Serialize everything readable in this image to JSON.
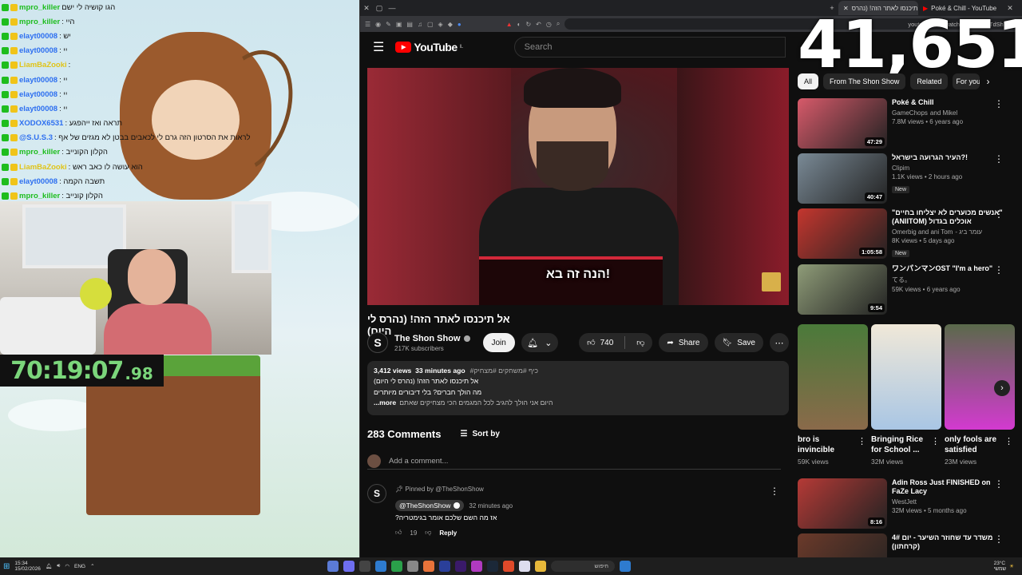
{
  "stream": {
    "chat": [
      {
        "name": "mpro_killer",
        "msg": "הגו קושיה לי ישם",
        "color": "green"
      },
      {
        "name": "mpro_killer",
        "msg": ": היי",
        "color": "green"
      },
      {
        "name": "elayt00008",
        "msg": ": יש",
        "color": "blue"
      },
      {
        "name": "elayt00008",
        "msg": ": יי",
        "color": "blue"
      },
      {
        "name": "LiamBaZooki",
        "msg": ":",
        "color": "yellow"
      },
      {
        "name": "elayt00008",
        "msg": ": יי",
        "color": "blue"
      },
      {
        "name": "elayt00008",
        "msg": ": יי",
        "color": "blue"
      },
      {
        "name": "elayt00008",
        "msg": ": יי",
        "color": "blue"
      },
      {
        "name": "XODOX6531",
        "msg": ": תראה ואז ייהפגע",
        "color": "blue"
      },
      {
        "name": "@S.U.S.3",
        "msg": ": לראות את הסרטון הזה גרם לי לכאבים בבטן לא מגזים של אף",
        "color": "blue"
      },
      {
        "name": "mpro_killer",
        "msg": ": הקלון הקונייב",
        "color": "green"
      },
      {
        "name": "LiamBaZooki",
        "msg": ": הוא עושה לו כאב ראש",
        "color": "yellow"
      },
      {
        "name": "elayt00008",
        "msg": ": תשבה הקמה",
        "color": "blue"
      },
      {
        "name": "mpro_killer",
        "msg": ": הקלון קונייב",
        "color": "green"
      }
    ],
    "timer_main": "70:19:07",
    "timer_ms": ".98"
  },
  "browser": {
    "tabs": [
      {
        "label": "אל תיכנסו לאתר הזה! (נהרס",
        "active": true
      },
      {
        "label": "Poké & Chill - YouTube",
        "active": false
      }
    ],
    "address": "youtube.com/watch?v=...vM4bTdShY8"
  },
  "youtube": {
    "logo": "YouTube",
    "logo_country": "IL",
    "search_placeholder": "Search",
    "overlay_counter": "41,651",
    "video": {
      "caption": "הנה זה בא!",
      "title": "אל תיכנסו לאתר הזה! (נהרס לי היום)",
      "channel": "The Shon Show",
      "subscribers": "217K subscribers",
      "join": "Join",
      "likes": "740",
      "share": "Share",
      "save": "Save",
      "views": "3,412 views",
      "ago": "33 minutes ago",
      "tags": "#כיף #משחקים #מצחיק",
      "desc_line1": "אל תיכנסו לאתר הזה! (נהרס לי היום)",
      "desc_line2": "מה הולך חברים? בלי דיבורים מיותרים",
      "desc_line3": "היום אני הולך להגיב לכל המגמים הכי מצחיקים שאתם",
      "more": "...more"
    },
    "comments": {
      "count": "283 Comments",
      "sort": "Sort by",
      "add_placeholder": "Add a comment...",
      "pinned_by": "Pinned by @TheShonShow",
      "author": "@TheShonShow",
      "time": "32 minutes ago",
      "text": "אז מה השם שלכם אומר בגימטריה?",
      "likes": "19",
      "reply": "Reply"
    },
    "chips": [
      "All",
      "From The Shon Show",
      "Related",
      "For you"
    ],
    "recommendations": [
      {
        "title": "Poké & Chill",
        "channel": "GameChops",
        "extra": "and Mikel",
        "meta": "7.8M views • 6 years ago",
        "duration": "47:29",
        "badge": "",
        "color": "#d75a6a"
      },
      {
        "title": "העיר הגרועה בישראל?!",
        "channel": "Clipim",
        "extra": "",
        "meta": "1.1K views • 2 hours ago",
        "duration": "40:47",
        "badge": "New",
        "color": "#7a8a96"
      },
      {
        "title": "\"אנשים מכוערים לא יצליחו בחיים\" (ANIITOM) אוכלים בגדול",
        "channel": "Omerbig and ani Tom",
        "extra": "- עומר ביג",
        "meta": "8K views • 5 days ago",
        "duration": "1:05:58",
        "badge": "New",
        "color": "#c4362e"
      },
      {
        "title": "ワンパンマンOST \"I'm a hero\"",
        "channel": "てる。",
        "extra": "",
        "meta": "59K views • 6 years ago",
        "duration": "9:54",
        "badge": "",
        "color": "#8f9c78"
      },
      {
        "title": "Adin Ross Just FINISHED on FaZe Lacy",
        "channel": "WestJett",
        "extra": "",
        "meta": "32M views • 5 months ago",
        "duration": "8:16",
        "badge": "",
        "color": "#b53a36"
      },
      {
        "title": "4# משדר עד שחוזר השיער - יום (קרחתון)",
        "channel": "",
        "extra": "",
        "meta": "",
        "duration": "",
        "badge": "",
        "color": "#6b3a2a"
      }
    ],
    "shorts": [
      {
        "title": "bro is invincible",
        "views": "59K views",
        "color": "#5a7a4a"
      },
      {
        "title": "Bringing Rice for School ...",
        "views": "32M views",
        "color": "#a9c6e4"
      },
      {
        "title": "only fools are satisfied",
        "views": "23M views",
        "color": "#7a4a8a"
      }
    ]
  },
  "taskbar": {
    "time": "15:34",
    "date": "15/02/2026",
    "lang": "ENG",
    "search": "חיפוש",
    "temp": "23°C",
    "weather": "שמשי"
  }
}
